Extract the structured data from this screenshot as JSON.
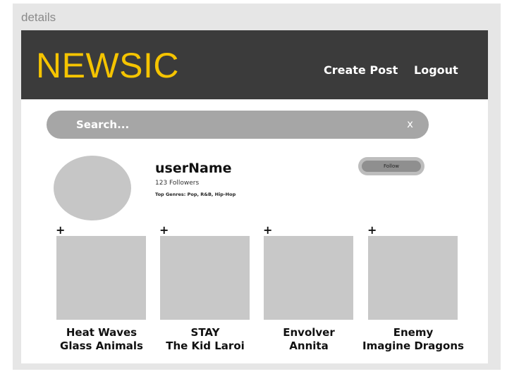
{
  "artboard": {
    "label": "details"
  },
  "header": {
    "logo": "NEWSIC",
    "nav": {
      "create_post": "Create Post",
      "logout": "Logout"
    }
  },
  "search": {
    "placeholder": "Search...",
    "clear": "x"
  },
  "profile": {
    "username": "userName",
    "followers": "123 Followers",
    "genres": "Top Genres: Pop, R&B, Hip-Hop",
    "follow_label": "Follow"
  },
  "songs": [
    {
      "add": "+",
      "title": "Heat Waves",
      "artist": "Glass Animals"
    },
    {
      "add": "+",
      "title": "STAY",
      "artist": "The Kid Laroi"
    },
    {
      "add": "+",
      "title": "Envolver",
      "artist": "Annita"
    },
    {
      "add": "+",
      "title": "Enemy",
      "artist": "Imagine Dragons"
    }
  ],
  "colors": {
    "header_bg": "#3b3b3b",
    "logo": "#f5c400",
    "placeholder_gray": "#c8c8c8"
  }
}
